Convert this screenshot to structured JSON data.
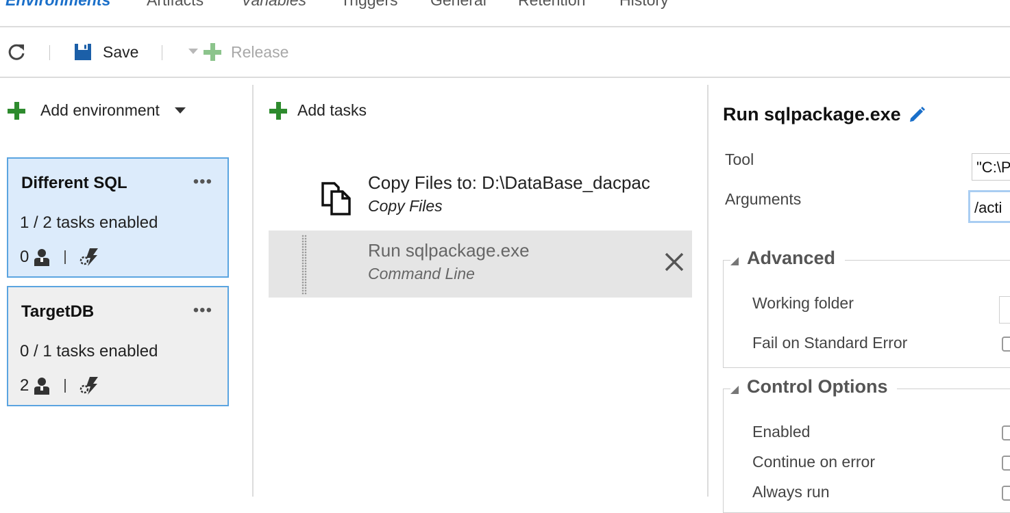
{
  "tabs": [
    {
      "label": "Environments"
    },
    {
      "label": "Artifacts"
    },
    {
      "label": "Variables"
    },
    {
      "label": "Triggers"
    },
    {
      "label": "General"
    },
    {
      "label": "Retention"
    },
    {
      "label": "History"
    }
  ],
  "toolbar": {
    "refresh_icon": "refresh-icon",
    "save_label": "Save",
    "release_label": "Release"
  },
  "left_panel": {
    "add_environment_label": "Add environment",
    "environments": [
      {
        "name": "Different SQL",
        "more": "•••",
        "tasks_enabled": "1 / 2 tasks enabled",
        "approvers": "0",
        "selected": true
      },
      {
        "name": "TargetDB",
        "more": "•••",
        "tasks_enabled": "0 / 1 tasks enabled",
        "approvers": "2",
        "selected": false
      }
    ]
  },
  "middle_panel": {
    "add_tasks_label": "Add tasks",
    "tasks": [
      {
        "title": "Copy Files to: D:\\DataBase_dacpac",
        "subtitle": "Copy Files",
        "icon": "copy-files-icon"
      },
      {
        "title": "Run sqlpackage.exe",
        "subtitle": "Command Line",
        "icon": "",
        "selected": true
      }
    ]
  },
  "right_panel": {
    "title": "Run sqlpackage.exe",
    "tool_label": "Tool",
    "tool_value": "\"C:\\P",
    "arguments_label": "Arguments",
    "arguments_value": "/acti",
    "advanced": {
      "title": "Advanced",
      "working_folder_label": "Working folder",
      "fail_on_stderr_label": "Fail on Standard Error"
    },
    "control_options": {
      "title": "Control Options",
      "enabled_label": "Enabled",
      "continue_on_error_label": "Continue on error",
      "always_run_label": "Always run"
    }
  },
  "colors": {
    "accent": "#1a6fc9",
    "add_green": "#2e8b2e",
    "selected_card": "#dcebfb",
    "card_border": "#5aa4e0"
  }
}
